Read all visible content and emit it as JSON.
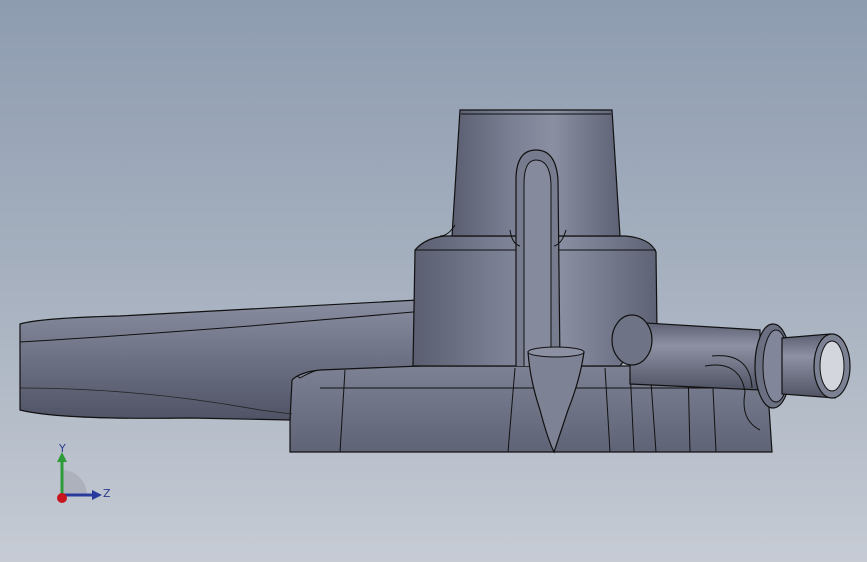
{
  "viewport": {
    "background_top": "#8e9cb0",
    "background_bottom": "#c6cbd4",
    "model_fill": "#6b6f82",
    "model_edge": "#111111"
  },
  "triad": {
    "y_label": "Y",
    "z_label": "Z",
    "y_color": "#2e9b3b",
    "z_color": "#2a3a9c",
    "x_color": "#c8141e"
  }
}
